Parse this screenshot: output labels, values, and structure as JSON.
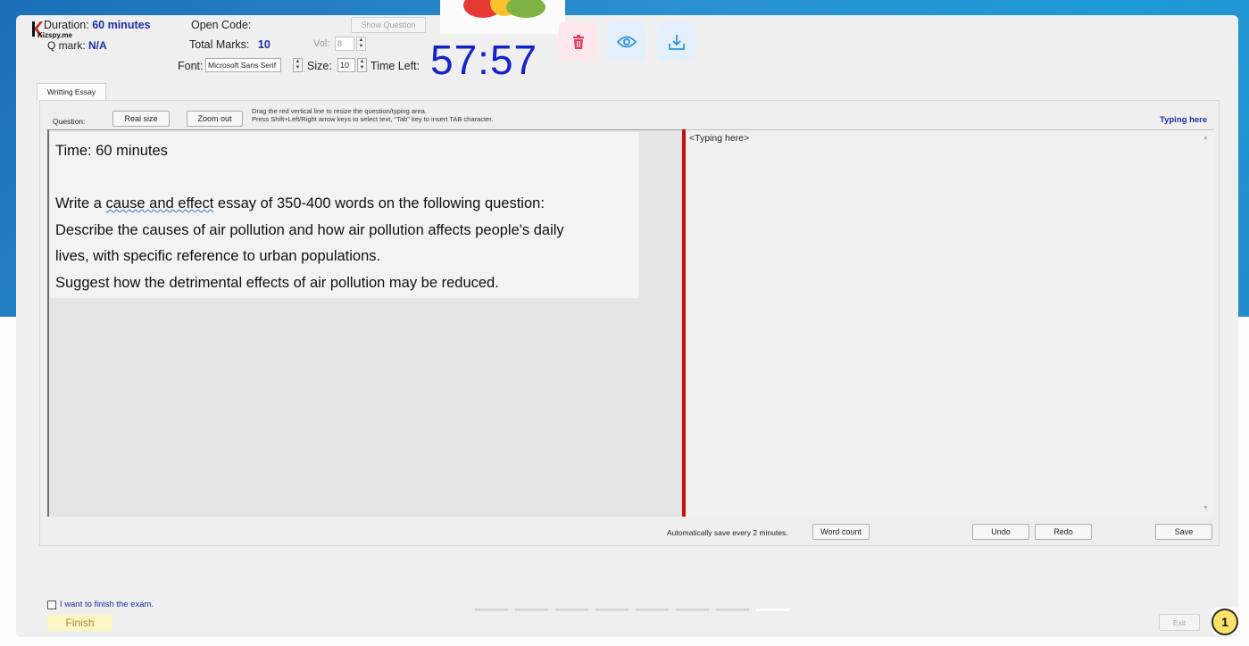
{
  "header": {
    "duration_label": "Duration:",
    "duration_value": "60 minutes",
    "brand": "Kizspy.me",
    "qmark_label": "Q mark:",
    "qmark_value": "N/A",
    "open_code_label": "Open Code:",
    "show_question_label": "Show Question",
    "total_marks_label": "Total Marks:",
    "total_marks_value": "10",
    "vol_label": "Vol:",
    "vol_value": "8",
    "font_label": "Font:",
    "font_value": "Microsoft Sans Serif",
    "size_label": "Size:",
    "size_value": "10",
    "time_left_label": "Time Left:",
    "time_left_value": "57:57"
  },
  "toolbar_icons": {
    "delete": "trash-icon",
    "preview": "eye-icon",
    "download": "download-icon",
    "delete_color": "#e8395a",
    "accent_color": "#2f8fe0"
  },
  "tab": {
    "label": "Writting Essay"
  },
  "question_bar": {
    "question_label": "Question:",
    "real_size_label": "Real size",
    "zoom_out_label": "Zoom out",
    "hint_line1": "Drag the red vertical line to resize the question/typing area.",
    "hint_line2": "Press Shift+Left/Right arrow keys to select text, \"Tab\" key to insert TAB character.",
    "typing_here_label": "Typing here"
  },
  "question": {
    "line1": "Time: 60 minutes",
    "line2_pre": "Write a ",
    "line2_err": "cause and effect",
    "line2_post": " essay of 350-400 words on the following question:",
    "line3": "Describe the causes of air pollution and how air pollution affects people's daily",
    "line4": "lives, with specific reference to urban populations.",
    "line5": "Suggest how the detrimental effects of air pollution may be reduced."
  },
  "answer": {
    "placeholder": "<Typing here>"
  },
  "footer": {
    "autosave_text": "Automatically save every 2 minutes.",
    "word_count_label": "Word count",
    "undo_label": "Undo",
    "redo_label": "Redo",
    "save_label": "Save",
    "finish_check_label": "I want to finish the exam.",
    "finish_label": "Finish",
    "exit_label": "Exit",
    "badge": "1"
  },
  "carousel": {
    "slide_count": 8,
    "active_index": 7
  }
}
